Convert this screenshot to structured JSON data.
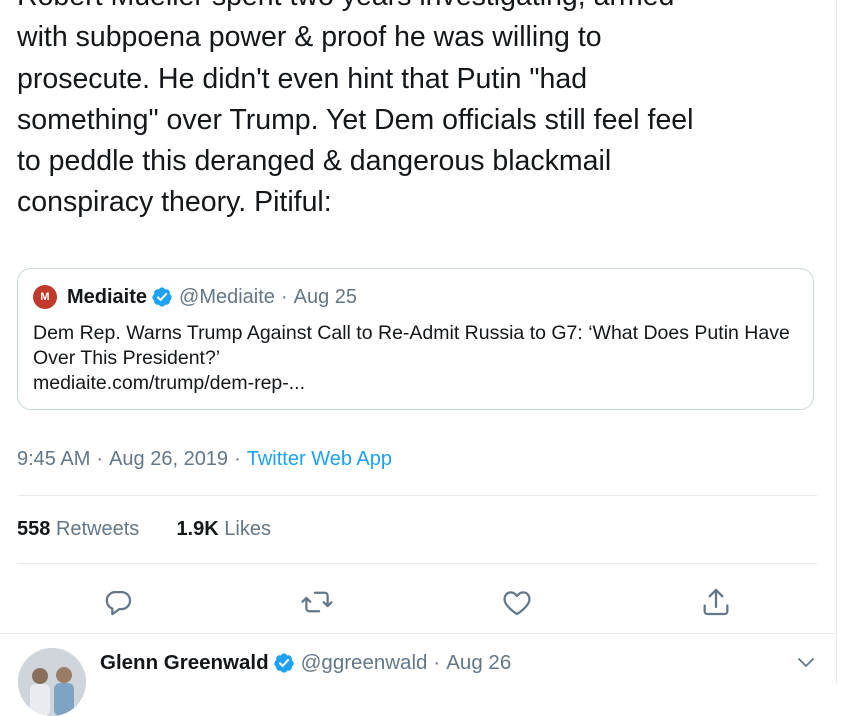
{
  "tweet": {
    "text": "Robert Mueller spent two years investigating, armed\nwith subpoena power & proof he was willing to\nprosecute. He didn't even hint that Putin \"had\nsomething\" over Trump. Yet Dem officials still feel feel\nto peddle this deranged & dangerous blackmail\nconspiracy theory. Pitiful:",
    "time": "9:45 AM",
    "date": "Aug 26, 2019",
    "app": "Twitter Web App",
    "retweets_count": "558",
    "retweets_label": "Retweets",
    "likes_count": "1.9K",
    "likes_label": "Likes"
  },
  "quote": {
    "avatar_letter": "M",
    "name": "Mediaite",
    "handle": "@Mediaite",
    "date": "Aug 25",
    "text": "Dem Rep. Warns Trump Against Call to Re-Admit Russia to G7: ‘What Does Putin Have Over This President?’",
    "link": "mediaite.com/trump/dem-rep-..."
  },
  "separators": {
    "dot": "·"
  },
  "actions": [
    "reply-icon",
    "retweet-icon",
    "like-icon",
    "share-icon"
  ],
  "reply": {
    "name": "Glenn Greenwald",
    "handle": "@ggreenwald",
    "date": "Aug 26"
  },
  "colors": {
    "accent": "#1da1f2",
    "secondary_text": "#657786",
    "border": "#e6ecf0",
    "brand_red": "#c0392b"
  }
}
